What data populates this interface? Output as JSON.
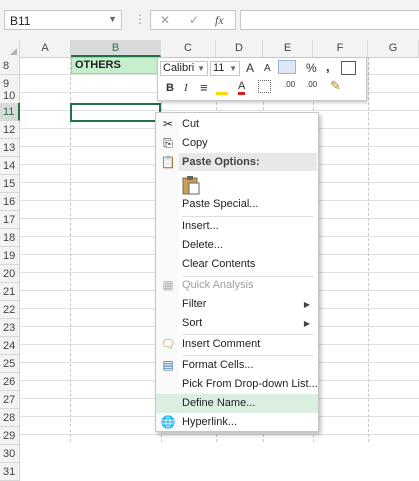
{
  "formula_bar": {
    "name_box": "B11",
    "separator": "⋮",
    "cancel": "✕",
    "enter": "✓",
    "fx": "fx",
    "formula": ""
  },
  "columns": [
    "A",
    "B",
    "C",
    "D",
    "E",
    "F",
    "G"
  ],
  "selected_column": "B",
  "rows": [
    "8",
    "9",
    "10",
    "11",
    "12",
    "13",
    "14",
    "15",
    "16",
    "17",
    "18",
    "19",
    "20",
    "21",
    "22",
    "23",
    "24",
    "25",
    "26",
    "27",
    "28",
    "29",
    "30",
    "31"
  ],
  "selected_row": "11",
  "cells": {
    "B8": "OTHERS"
  },
  "mini_toolbar": {
    "font": "Calibri",
    "size": "11",
    "grow": "A",
    "shrink": "A",
    "percent": "%",
    "comma": ",",
    "bold": "B",
    "italic": "I",
    "align": "≡",
    "font_color": "A",
    "inc_decimal": ".00",
    "dec_decimal": ".00"
  },
  "context_menu": {
    "cut": "Cut",
    "copy": "Copy",
    "paste_options": "Paste Options:",
    "paste_special": "Paste Special...",
    "insert": "Insert...",
    "delete": "Delete...",
    "clear_contents": "Clear Contents",
    "quick_analysis": "Quick Analysis",
    "filter": "Filter",
    "sort": "Sort",
    "insert_comment": "Insert Comment",
    "format_cells": "Format Cells...",
    "pick_list": "Pick From Drop-down List...",
    "define_name": "Define Name...",
    "hyperlink": "Hyperlink..."
  },
  "colors": {
    "accent": "#217346",
    "highlight": "#dbefe0",
    "cell_fill": "#c6efce"
  }
}
